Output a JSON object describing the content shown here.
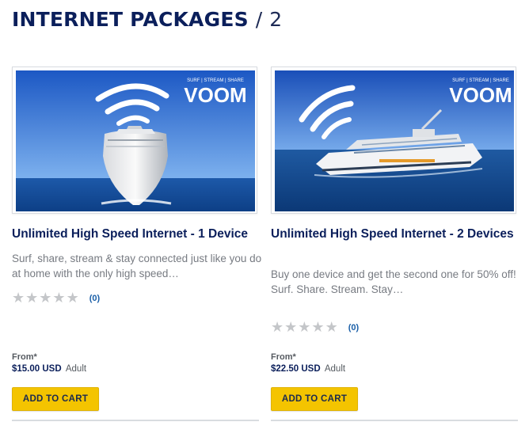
{
  "page": {
    "heading": "INTERNET PACKAGES",
    "separator": "/",
    "count": "2"
  },
  "products": [
    {
      "brand_logo": "VOOM",
      "brand_tagline": "SURF | STREAM | SHARE",
      "image_subject": "cruise ship bow, front view",
      "title": "Unlimited High Speed Internet - 1 Device",
      "description": "Surf, share, stream & stay connected just like you do at home with the only high speed…",
      "stars": 0,
      "review_count": "(0)",
      "from_label": "From*",
      "price": "$15.00 USD",
      "price_unit": "Adult",
      "cta": "ADD TO CART"
    },
    {
      "brand_logo": "VOOM",
      "brand_tagline": "SURF | STREAM | SHARE",
      "image_subject": "cruise ship, side view at sea",
      "title": "Unlimited High Speed Internet - 2 Devices",
      "description_line1": "Buy one device and get the second one for 50% off!",
      "description_line2": "Surf. Share. Stream. Stay…",
      "stars": 0,
      "review_count": "(0)",
      "from_label": "From*",
      "price": "$22.50 USD",
      "price_unit": "Adult",
      "cta": "ADD TO CART"
    }
  ],
  "colors": {
    "heading": "#0b1f5b",
    "button": "#f4c400",
    "link": "#1a5fa8",
    "star_empty": "#c4c6c9"
  },
  "icons": [
    "wifi-waves-icon",
    "star-icon"
  ]
}
